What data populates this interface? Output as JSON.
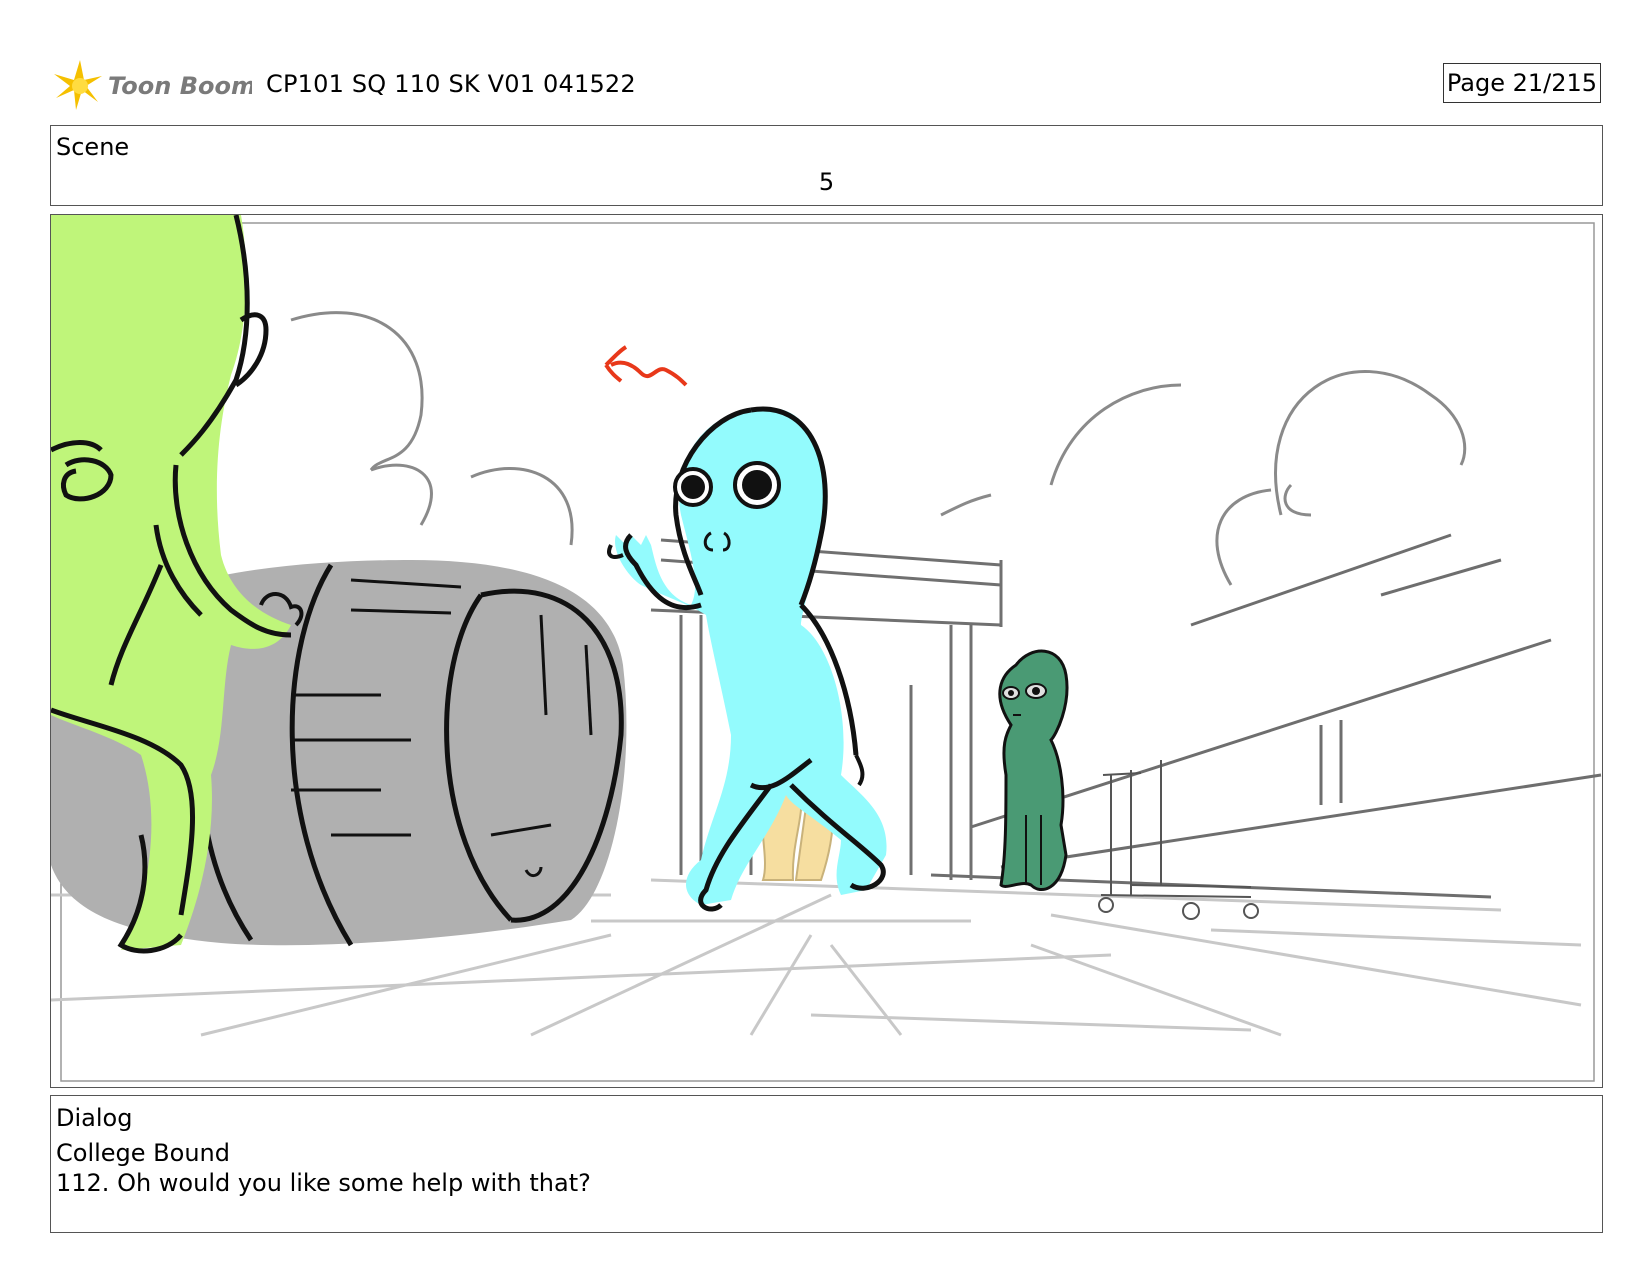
{
  "header": {
    "logo_text": "Toon Boom",
    "document_title": "CP101 SQ 110 SK V01 041522",
    "page_label": "Page  21/215"
  },
  "scene": {
    "label": "Scene",
    "number": "5"
  },
  "dialog": {
    "label": "Dialog",
    "character": "College Bound",
    "line": "112. Oh would you like some help with that?"
  },
  "colors": {
    "logo_star": "#f5c000",
    "green_character": "#bff57a",
    "blue_character": "#93fbfd",
    "dark_green_character": "#4a9a74",
    "barrel": "#b0b0b0",
    "arrow_accent": "#e8381a"
  }
}
